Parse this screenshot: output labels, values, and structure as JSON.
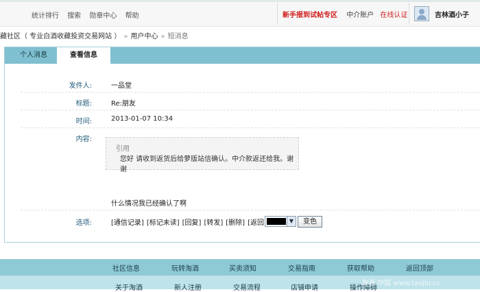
{
  "top_nav": {
    "items": [
      "统计排行",
      "搜索",
      "勋章中心",
      "帮助"
    ],
    "promo_link": "新手报到试帖专区",
    "account_label": "中介账户",
    "verify_link": "在线认证",
    "username": "吉林酒小子"
  },
  "breadcrumb": {
    "site": "藏社区（ 专业白酒收藏投资交易网站 ）",
    "sep1": "»",
    "user_center": "用户中心",
    "sep2": "»",
    "current": "短消息"
  },
  "tabs": [
    {
      "label": "个人消息",
      "active": false
    },
    {
      "label": "查看信息",
      "active": true
    }
  ],
  "message": {
    "sender_label": "发件人:",
    "sender": "一品堂",
    "subject_label": "标题:",
    "subject": "Re:朋友",
    "time_label": "时间:",
    "time": "2013-01-07 10:34",
    "content_label": "内容:",
    "quote_title": "引用",
    "quote_body": "您好  请收到返货后给萝版站信确认。中介款返还给我。谢谢",
    "reply_text": "什么情况我已经确认了啊"
  },
  "options": {
    "label": "选项:",
    "actions": [
      "[通信记录]",
      "[标记未读]",
      "[回复]",
      "[转发]",
      "[删除]",
      "[返回]"
    ],
    "color_value": "#000000",
    "color_button": "变色"
  },
  "footer": {
    "row1": [
      "社区信息",
      "玩转淘酒",
      "买卖须知",
      "交易指南",
      "获取帮助",
      "返回顶部"
    ],
    "row2": [
      "关于淘酒",
      "新人注册",
      "交易流程",
      "店铺申请",
      "操作障碍"
    ]
  },
  "watermark": "淘酒.中国  www.taojiu.cc",
  "colors": {
    "tab_bar": "#7fbfcf",
    "footer_dark": "#8ecad6",
    "footer_light": "#bfe3ea",
    "accent_red": "#d01c1c",
    "label_blue": "#1f5a7a"
  }
}
